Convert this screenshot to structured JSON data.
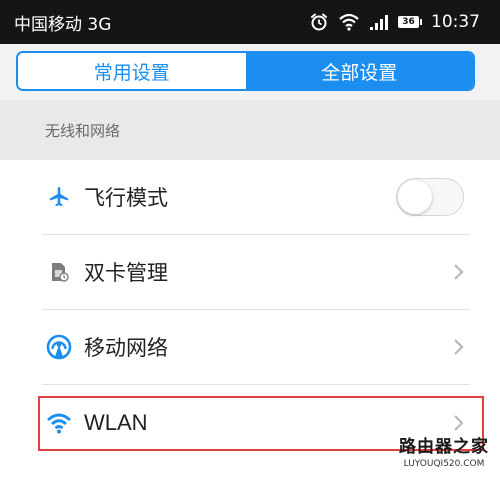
{
  "status_bar": {
    "carrier": "中国移动 3G",
    "battery": "36",
    "time": "10:37",
    "icons": [
      "alarm-icon",
      "wifi-icon",
      "signal-icon",
      "battery-icon"
    ]
  },
  "tabs": [
    {
      "label": "常用设置",
      "active": false
    },
    {
      "label": "全部设置",
      "active": true
    }
  ],
  "section": {
    "title": "无线和网络"
  },
  "items": [
    {
      "label": "飞行模式",
      "icon": "airplane-icon",
      "control": "toggle",
      "toggle_on": false
    },
    {
      "label": "双卡管理",
      "icon": "sim-card-icon",
      "control": "chevron"
    },
    {
      "label": "移动网络",
      "icon": "mobile-network-icon",
      "control": "chevron"
    },
    {
      "label": "WLAN",
      "icon": "wifi-icon",
      "control": "chevron",
      "highlighted": true
    }
  ],
  "watermark": {
    "title": "路由器之家",
    "url": "LUYOUQI520.COM"
  },
  "colors": {
    "accent": "#1b8ef0",
    "status_bar": "#151515",
    "highlight": "#e34040"
  }
}
